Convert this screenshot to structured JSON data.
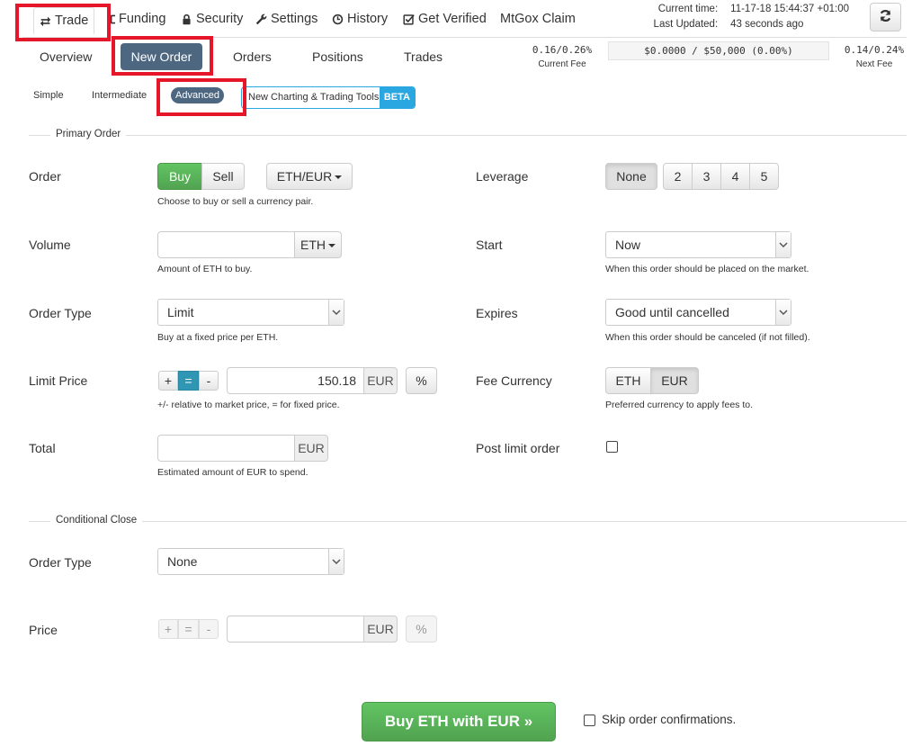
{
  "nav": {
    "items": [
      {
        "label": "Trade",
        "icon": "exchange-icon"
      },
      {
        "label": "Funding",
        "icon": "wallet-icon"
      },
      {
        "label": "Security",
        "icon": "lock-icon"
      },
      {
        "label": "Settings",
        "icon": "wrench-icon"
      },
      {
        "label": "History",
        "icon": "clock-icon"
      },
      {
        "label": "Get Verified",
        "icon": "check-square-icon"
      },
      {
        "label": "MtGox Claim",
        "icon": ""
      }
    ]
  },
  "status": {
    "current_time_label": "Current time:",
    "current_time_value": "11-17-18 15:44:37 +01:00",
    "last_updated_label": "Last Updated:",
    "last_updated_value": "43 seconds ago",
    "refresh_icon": "refresh-icon"
  },
  "tabs": {
    "overview": "Overview",
    "new_order": "New Order",
    "orders": "Orders",
    "positions": "Positions",
    "trades": "Trades"
  },
  "fees": {
    "current_value": "0.16/0.26%",
    "current_label": "Current Fee",
    "balance": "$0.0000 / $50,000 (0.00%)",
    "next_value": "0.14/0.24%",
    "next_label": "Next Fee"
  },
  "modes": {
    "simple": "Simple",
    "intermediate": "Intermediate",
    "advanced": "Advanced",
    "charting": "New Charting & Trading Tools",
    "beta": "BETA"
  },
  "primary": {
    "legend": "Primary Order",
    "order_label": "Order",
    "buy": "Buy",
    "sell": "Sell",
    "pair": "ETH/EUR",
    "order_help": "Choose to buy or sell a currency pair.",
    "volume_label": "Volume",
    "volume_value": "",
    "volume_unit": "ETH",
    "volume_help": "Amount of ETH to buy.",
    "order_type_label": "Order Type",
    "order_type_value": "Limit",
    "order_type_help": "Buy at a fixed price per ETH.",
    "limit_price_label": "Limit Price",
    "plus": "+",
    "equals": "=",
    "minus": "-",
    "limit_price_value": "150.18",
    "limit_price_unit": "EUR",
    "percent": "%",
    "limit_price_help": "+/- relative to market price, = for fixed price.",
    "total_label": "Total",
    "total_value": "",
    "total_unit": "EUR",
    "total_help": "Estimated amount of EUR to spend.",
    "leverage_label": "Leverage",
    "leverage_options": [
      "None",
      "2",
      "3",
      "4",
      "5"
    ],
    "start_label": "Start",
    "start_value": "Now",
    "start_help": "When this order should be placed on the market.",
    "expires_label": "Expires",
    "expires_value": "Good until cancelled",
    "expires_help": "When this order should be canceled (if not filled).",
    "fee_currency_label": "Fee Currency",
    "fee_eth": "ETH",
    "fee_eur": "EUR",
    "fee_currency_help": "Preferred currency to apply fees to.",
    "post_limit_label": "Post limit order"
  },
  "conditional": {
    "legend": "Conditional Close",
    "order_type_label": "Order Type",
    "order_type_value": "None",
    "price_label": "Price",
    "plus": "+",
    "equals": "=",
    "minus": "-",
    "price_value": "",
    "price_unit": "EUR",
    "percent": "%"
  },
  "footer": {
    "submit": "Buy ETH with EUR »",
    "skip_label": "Skip order confirmations."
  },
  "colors": {
    "highlight_box": "#e5162a",
    "active_tab": "#4e6781",
    "buy_green": "#51a351",
    "beta_blue": "#2aa7e0"
  }
}
